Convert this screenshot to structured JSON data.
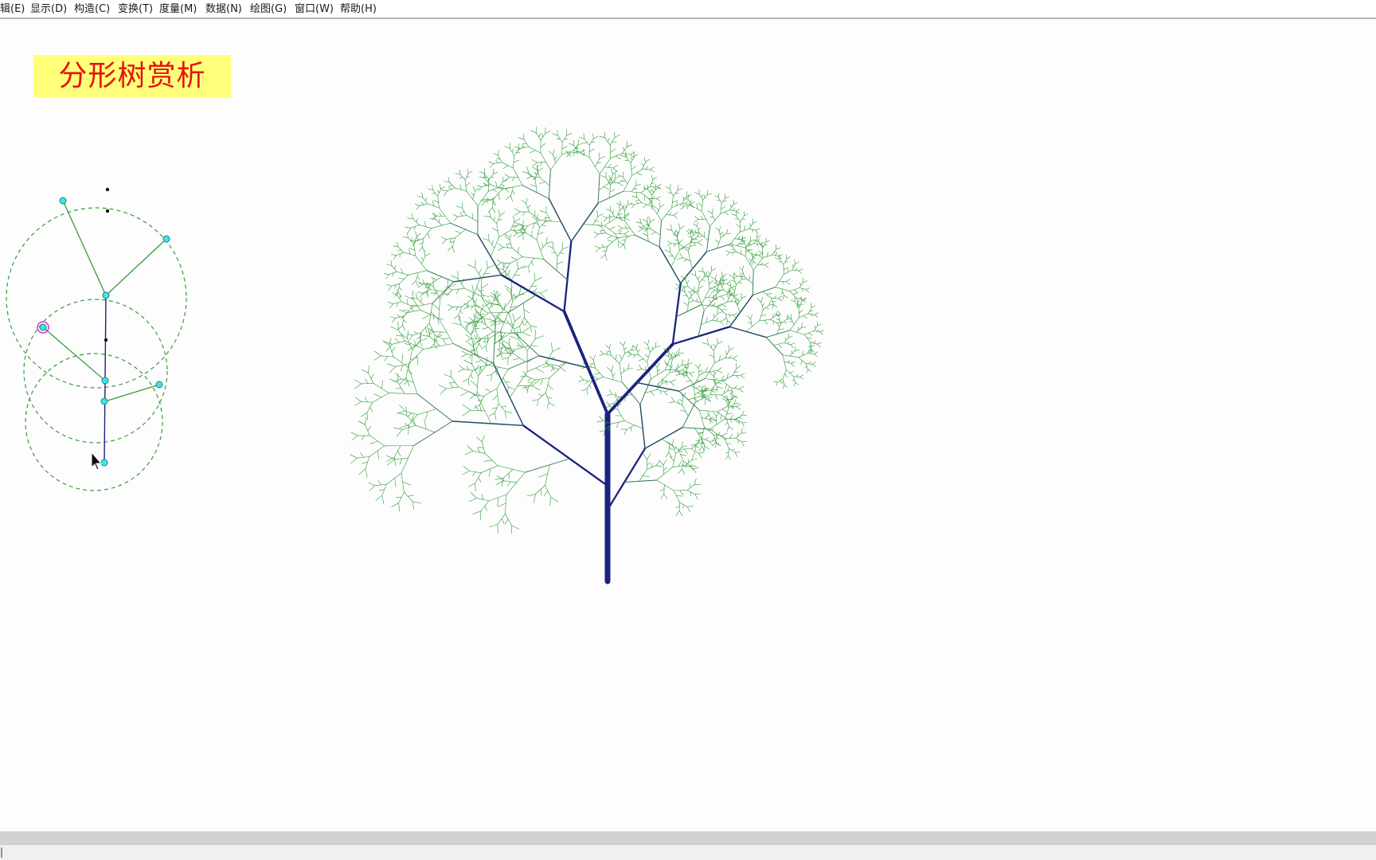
{
  "menu": {
    "items": [
      {
        "id": "edit",
        "label": "辑(E)"
      },
      {
        "id": "display",
        "label": "显示(D)"
      },
      {
        "id": "construct",
        "label": "构造(C)"
      },
      {
        "id": "transform",
        "label": "变换(T)"
      },
      {
        "id": "measure",
        "label": "度量(M)"
      },
      {
        "id": "data",
        "label": "数据(N)"
      },
      {
        "id": "graph",
        "label": "绘图(G)"
      },
      {
        "id": "window",
        "label": "窗口(W)"
      },
      {
        "id": "help",
        "label": "帮助(H)"
      }
    ]
  },
  "title": "分形树赏析",
  "status": {
    "text": "|"
  },
  "colors": {
    "title_text": "#e3140f",
    "title_bg": "#ffff7a",
    "trunk": "#1a237e",
    "leaf": "#2e9a36",
    "control_point": "#3ee6e6",
    "selected_point": "#d63ad6",
    "dashed_circle": "#3a9a3a"
  },
  "icons": {
    "cursor": "mouse-pointer-icon"
  }
}
